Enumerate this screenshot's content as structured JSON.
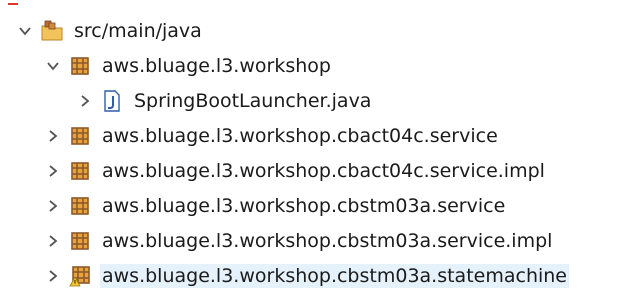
{
  "tree": {
    "source_folder": {
      "label": "src/main/java",
      "expanded": true,
      "icon": "source-folder-icon"
    },
    "items": [
      {
        "label": "aws.bluage.l3.workshop",
        "kind": "package",
        "expanded": true,
        "icon": "package-icon"
      },
      {
        "label": "SpringBootLauncher.java",
        "kind": "java-file",
        "expanded": false,
        "icon": "java-file-icon"
      },
      {
        "label": "aws.bluage.l3.workshop.cbact04c.service",
        "kind": "package",
        "expanded": false,
        "icon": "package-icon"
      },
      {
        "label": "aws.bluage.l3.workshop.cbact04c.service.impl",
        "kind": "package",
        "expanded": false,
        "icon": "package-icon"
      },
      {
        "label": "aws.bluage.l3.workshop.cbstm03a.service",
        "kind": "package",
        "expanded": false,
        "icon": "package-icon"
      },
      {
        "label": "aws.bluage.l3.workshop.cbstm03a.service.impl",
        "kind": "package",
        "expanded": false,
        "icon": "package-icon"
      },
      {
        "label": "aws.bluage.l3.workshop.cbstm03a.statemachine",
        "kind": "package",
        "expanded": false,
        "icon": "package-warning-icon",
        "selected": true
      }
    ]
  },
  "colors": {
    "package_brown": "#8b5a2b",
    "package_orange": "#e8a33a",
    "java_blue": "#2d5fa8",
    "selection": "#e5f1fb",
    "warning": "#f4c430",
    "chevron": "#555555"
  }
}
